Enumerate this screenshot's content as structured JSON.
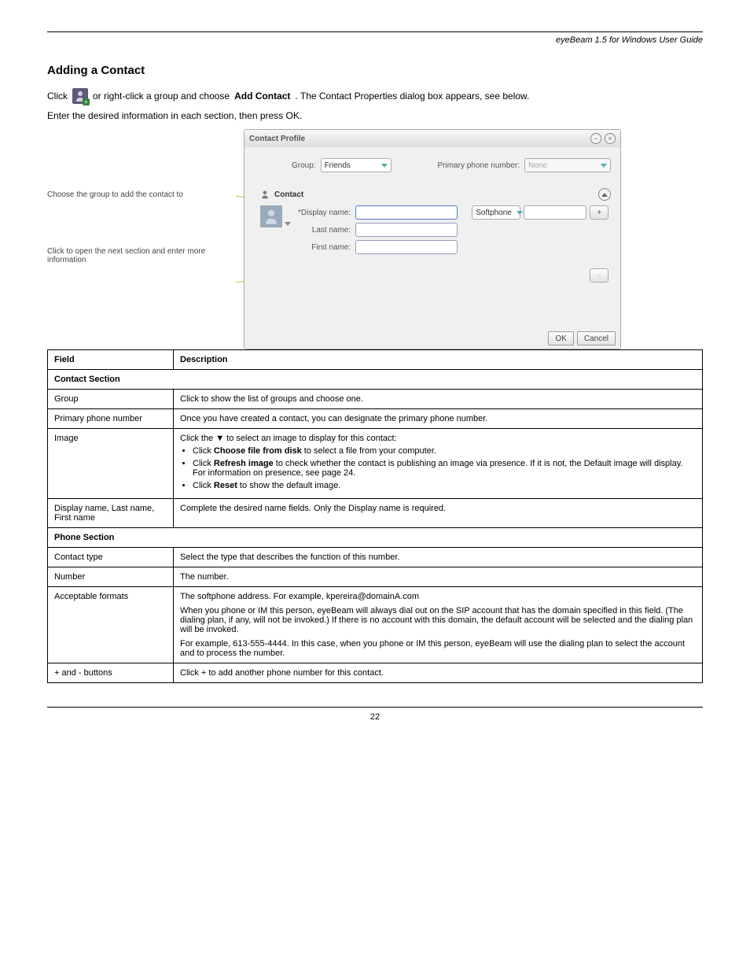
{
  "header": {
    "doc_title": "eyeBeam 1.5 for Windows User Guide"
  },
  "section": {
    "heading": "Adding a Contact",
    "p1_a": "Click ",
    "p1_b": " or right-click a group and choose ",
    "p1_c": "Add Contact",
    "p1_d": ". The Contact Properties dialog box appears, see below.",
    "p2": "Enter the desired information in each section, then press OK."
  },
  "dialog": {
    "title": "Contact Profile",
    "group_label": "Group:",
    "group_value": "Friends",
    "primary_label": "Primary phone number:",
    "primary_value": "None",
    "contact_header": "Contact",
    "display_name_label": "*Display name:",
    "last_name_label": "Last name:",
    "first_name_label": "First name:",
    "softphone_option": "Softphone",
    "plus_btn": "+",
    "minus_btn": "-",
    "ok": "OK",
    "cancel": "Cancel"
  },
  "callouts": {
    "co1": "Choose the group to add the contact to",
    "co2": "Click to open the next section and enter more information"
  },
  "table": {
    "h_field": "Field",
    "h_desc": "Description",
    "sub_contact": "Contact Section",
    "group_f": "Group",
    "group_d": "Click to show the list of groups and choose one.",
    "primary_f": "Primary phone number",
    "primary_d": "Once you have created a contact, you can designate the primary phone number.",
    "image_f": "Image",
    "image_d_intro": "Click the ▼ to select an image to display for this contact:",
    "image_d_b1_a": "Click ",
    "image_d_b1_b": "Choose file from disk",
    "image_d_b1_c": " to select a file from your computer.",
    "image_d_b2_a": "Click ",
    "image_d_b2_b": "Refresh image",
    "image_d_b2_c": " to check whether the contact is publishing an image via presence. If it is not, the Default image will display. For information on presence, see page 24.",
    "image_d_b3_a": "Click ",
    "image_d_b3_b": "Reset",
    "image_d_b3_c": " to show the default image.",
    "display_f": "Display name, Last name, First name",
    "display_d": "Complete the desired name fields. Only the Display name is required.",
    "sub_phone": "Phone Section",
    "contact_type_f": "Contact type",
    "contact_type_d": "Select the type that describes the function of this number.",
    "number_f": "Number",
    "number_d": "The number.",
    "format_f": "Acceptable formats",
    "format_d_p1": "The softphone address. For example, kpereira@domainA.com",
    "format_d_p2": "When you phone or IM this person, eyeBeam will always dial out on the SIP account that has the domain specified in this field. (The dialing plan, if any, will not be invoked.) If there is no account with this domain, the default account will be selected and the dialing plan will be invoked.",
    "format_d_p3": "For example, 613-555-4444. In this case, when you phone or IM this person, eyeBeam will use the dialing plan to select the account and to process the number.",
    "plusminus_f": "+ and - buttons",
    "plusminus_d": "Click + to add another phone number for this contact."
  },
  "footer": {
    "page": "22"
  }
}
